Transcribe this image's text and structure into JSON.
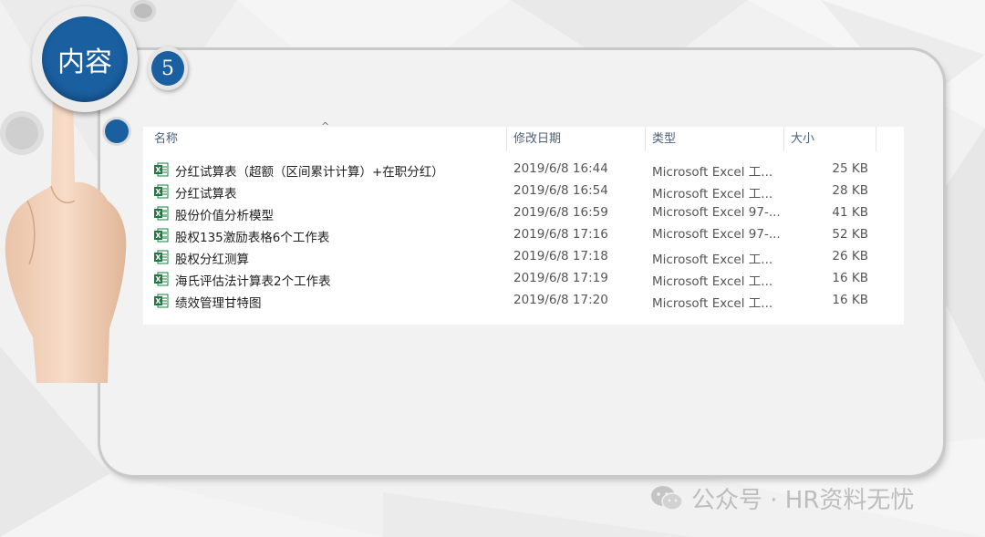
{
  "badge": {
    "label": "内容",
    "number": "5"
  },
  "explorer": {
    "columns": {
      "name": "名称",
      "date": "修改日期",
      "type": "类型",
      "size": "大小"
    },
    "files": [
      {
        "name": "分红试算表（超额（区间累计计算）+在职分红）",
        "date": "2019/6/8 16:44",
        "type": "Microsoft Excel 工...",
        "size": "25 KB",
        "icon": "excel-xlsx-icon"
      },
      {
        "name": "分红试算表",
        "date": "2019/6/8 16:54",
        "type": "Microsoft Excel 工...",
        "size": "28 KB",
        "icon": "excel-xlsx-icon"
      },
      {
        "name": "股份价值分析模型",
        "date": "2019/6/8 16:59",
        "type": "Microsoft Excel 97-...",
        "size": "41 KB",
        "icon": "excel-xls-icon"
      },
      {
        "name": "股权135激励表格6个工作表",
        "date": "2019/6/8 17:16",
        "type": "Microsoft Excel 97-...",
        "size": "52 KB",
        "icon": "excel-xls-icon"
      },
      {
        "name": "股权分红测算",
        "date": "2019/6/8 17:18",
        "type": "Microsoft Excel 工...",
        "size": "26 KB",
        "icon": "excel-xlsx-icon"
      },
      {
        "name": "海氏评估法计算表2个工作表",
        "date": "2019/6/8 17:19",
        "type": "Microsoft Excel 工...",
        "size": "16 KB",
        "icon": "excel-xlsx-icon"
      },
      {
        "name": "绩效管理甘特图",
        "date": "2019/6/8 17:20",
        "type": "Microsoft Excel 工...",
        "size": "16 KB",
        "icon": "excel-xlsx-icon"
      }
    ]
  },
  "watermark": {
    "text": "公众号 · HR资料无忧",
    "icon": "wechat-icon"
  },
  "colors": {
    "accent_blue": "#1a5fa0",
    "excel_green": "#1d7a3e",
    "header_text": "#4c607a"
  }
}
